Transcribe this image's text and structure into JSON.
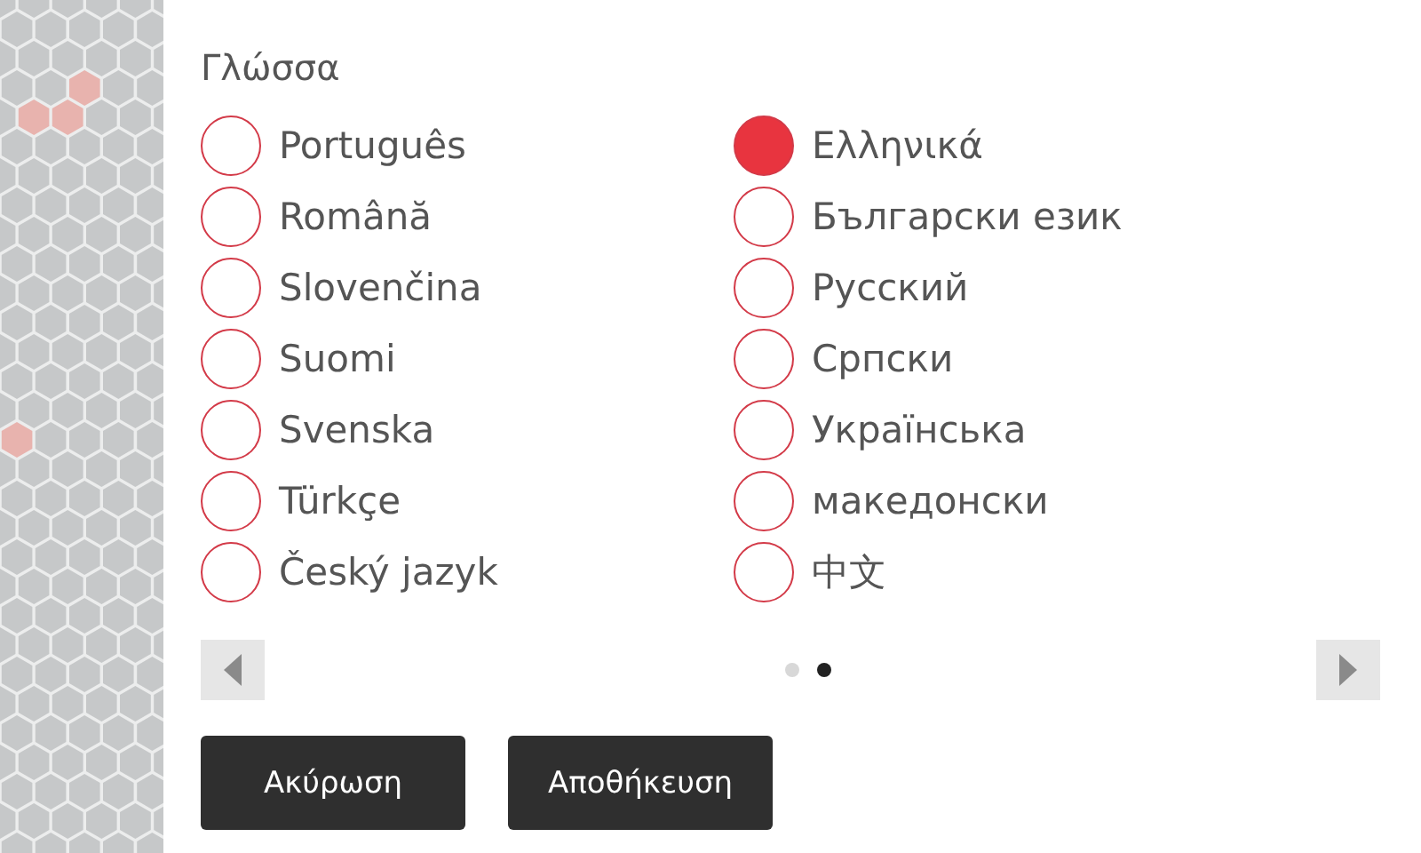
{
  "title": "Γλώσσα",
  "languages": [
    {
      "label": "Português",
      "selected": false
    },
    {
      "label": "Română",
      "selected": false
    },
    {
      "label": "Slovenčina",
      "selected": false
    },
    {
      "label": "Suomi",
      "selected": false
    },
    {
      "label": "Svenska",
      "selected": false
    },
    {
      "label": "Türkçe",
      "selected": false
    },
    {
      "label": "Český jazyk",
      "selected": false
    },
    {
      "label": "Ελληνικά",
      "selected": true
    },
    {
      "label": "Български език",
      "selected": false
    },
    {
      "label": "Русский",
      "selected": false
    },
    {
      "label": "Српски",
      "selected": false
    },
    {
      "label": "Українська",
      "selected": false
    },
    {
      "label": "македонски",
      "selected": false
    },
    {
      "label": "中文",
      "selected": false
    }
  ],
  "pages": [
    {
      "selected": false
    },
    {
      "selected": true
    }
  ],
  "buttons": [
    "Ακύρωση",
    "Αποθήκευση"
  ]
}
